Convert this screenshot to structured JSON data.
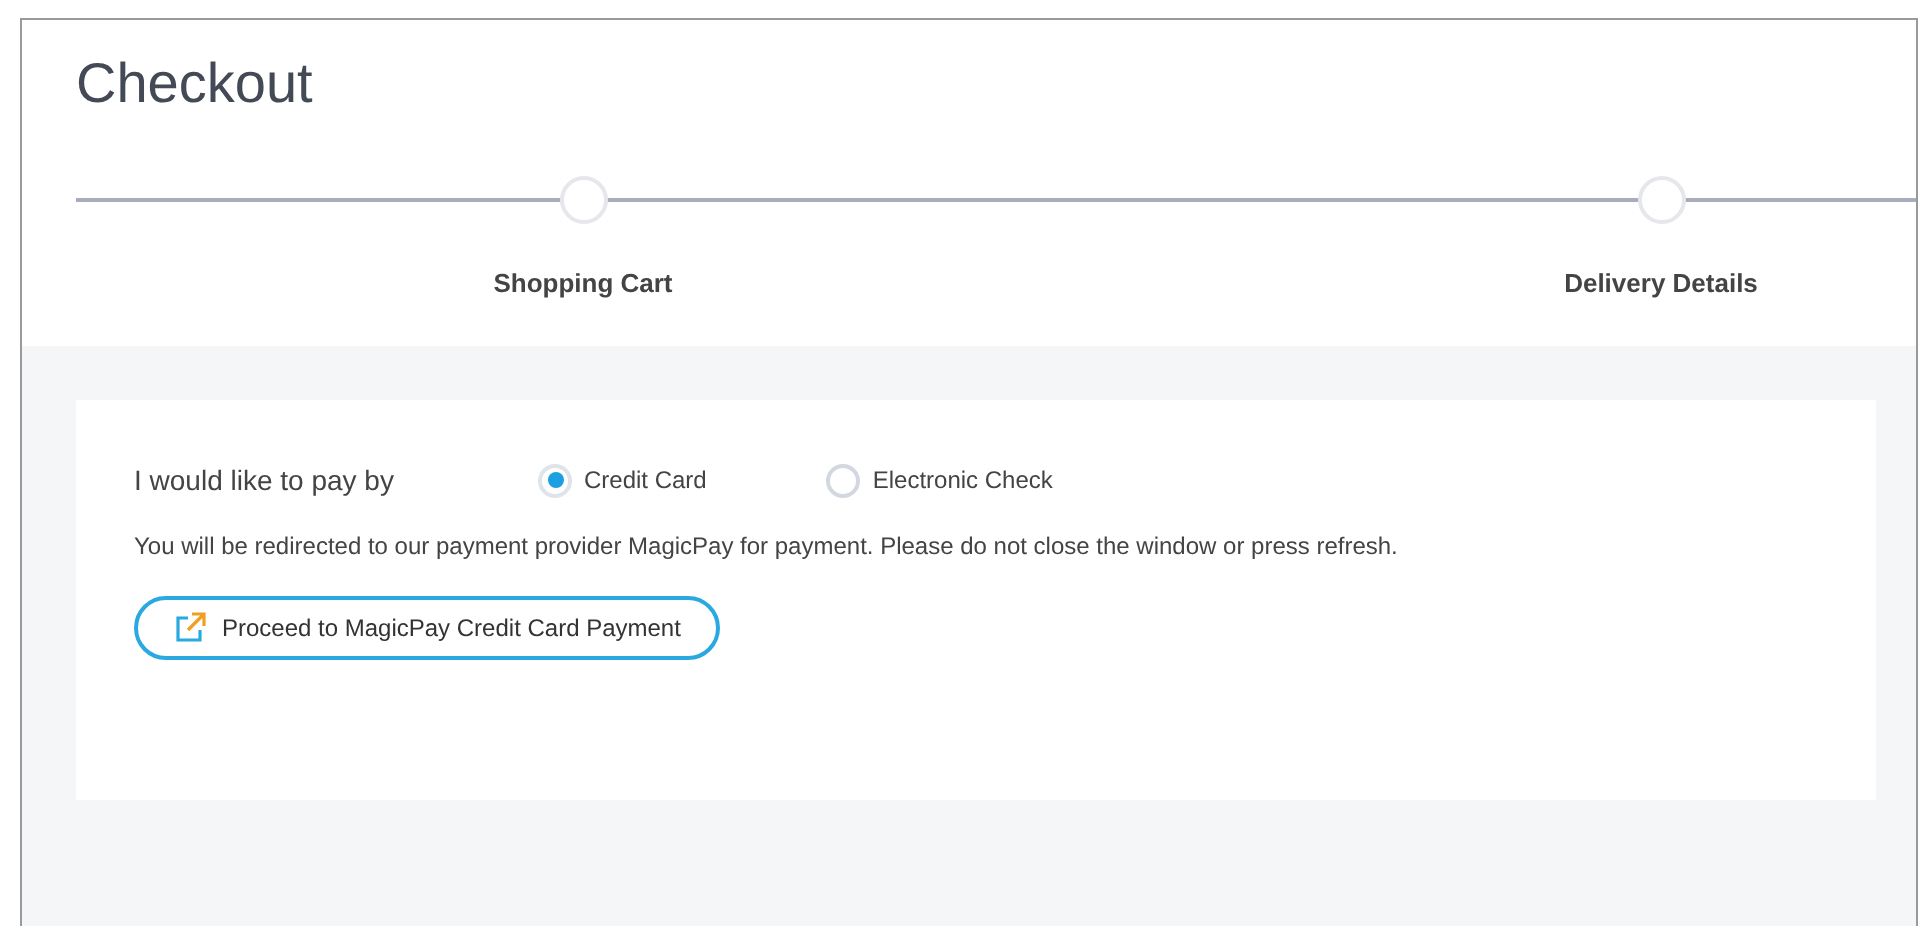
{
  "page": {
    "title": "Checkout"
  },
  "steps": [
    {
      "label": "Shopping Cart"
    },
    {
      "label": "Delivery Details"
    }
  ],
  "payment": {
    "prompt": "I would like to pay by",
    "options": [
      {
        "label": "Credit Card",
        "selected": true
      },
      {
        "label": "Electronic Check",
        "selected": false
      }
    ],
    "notice": "You will be redirected to our payment provider MagicPay for payment. Please do not close the window or press refresh.",
    "button": "Proceed to MagicPay Credit Card Payment"
  }
}
